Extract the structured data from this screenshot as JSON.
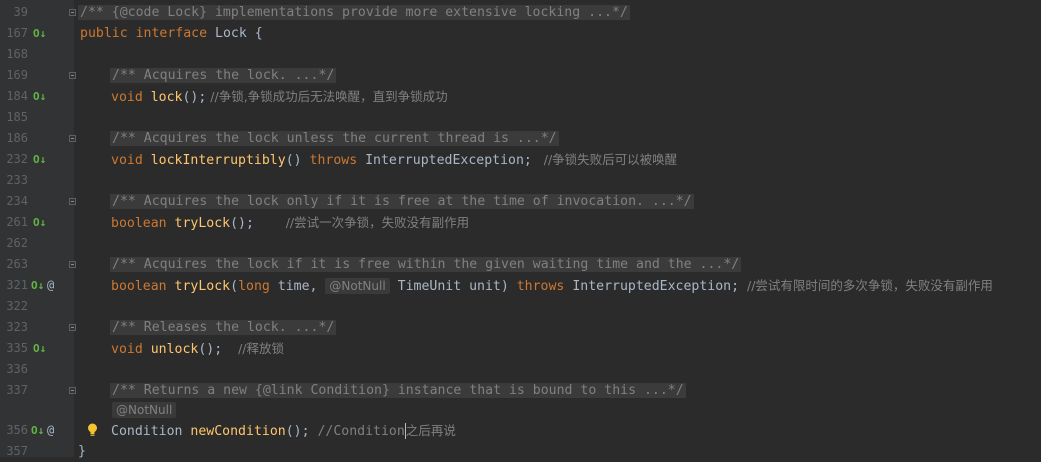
{
  "lines": [
    {
      "num": "39",
      "text": "/** {@code Lock} implementations provide more extensive locking ...*/"
    },
    {
      "num": "167",
      "kw1": "public",
      "kw2": "interface",
      "name": "Lock",
      "brace": " {"
    },
    {
      "num": "168"
    },
    {
      "num": "169",
      "text": "/** Acquires the lock. ...*/"
    },
    {
      "num": "184",
      "type": "void",
      "method": "lock",
      "rest": "();",
      "comment": " //争锁,争锁成功后无法唤醒，直到争锁成功"
    },
    {
      "num": "185"
    },
    {
      "num": "186",
      "text": "/** Acquires the lock unless the current thread is ...*/"
    },
    {
      "num": "232",
      "type": "void",
      "method": "lockInterruptibly",
      "rest": "() ",
      "throws": "throws",
      "exc": " InterruptedException;",
      "comment": "   //争锁失败后可以被唤醒"
    },
    {
      "num": "233"
    },
    {
      "num": "234",
      "text": "/** Acquires the lock only if it is free at the time of invocation. ...*/"
    },
    {
      "num": "261",
      "type": "boolean",
      "method": "tryLock",
      "rest": "();    ",
      "comment": "//尝试一次争锁，失败没有副作用"
    },
    {
      "num": "262"
    },
    {
      "num": "263",
      "text": "/** Acquires the lock if it is free within the given waiting time and the ...*/"
    },
    {
      "num": "321",
      "type": "boolean",
      "method": "tryLock",
      "p1": "(",
      "p_type": "long",
      "p_name": " time, ",
      "ann": "@NotNull",
      "p2": " TimeUnit unit) ",
      "throws": "throws",
      "exc": " InterruptedException;",
      "comment": "  //尝试有限时间的多次争锁，失败没有副作用"
    },
    {
      "num": "322"
    },
    {
      "num": "323",
      "text": "/** Releases the lock. ...*/"
    },
    {
      "num": "335",
      "type": "void",
      "method": "unlock",
      "rest": "();  ",
      "comment": "//释放锁"
    },
    {
      "num": "336"
    },
    {
      "num": "337",
      "text": "/** Returns a new {@link Condition} instance that is bound to this ...*/"
    },
    {
      "num": "",
      "ann": "@NotNull"
    },
    {
      "num": "356",
      "type": "Condition",
      "method": "newCondition",
      "rest": "(); ",
      "comment_a": "//Condition",
      "comment_b": "之后再说"
    },
    {
      "num": "357",
      "text": "}"
    }
  ],
  "colors": {
    "background": "#2b2b2b",
    "gutter": "#313335",
    "keyword": "#cc7832",
    "method": "#ffc66d",
    "comment": "#808080",
    "impl_marker": "#62b543"
  },
  "icons": {
    "impl_marker": "implemented-by-icon",
    "annotation": "at-icon",
    "fold": "fold-icon",
    "intention": "lightbulb-icon"
  },
  "gutter_marks": {
    "impl": "O↓",
    "at": "@"
  }
}
